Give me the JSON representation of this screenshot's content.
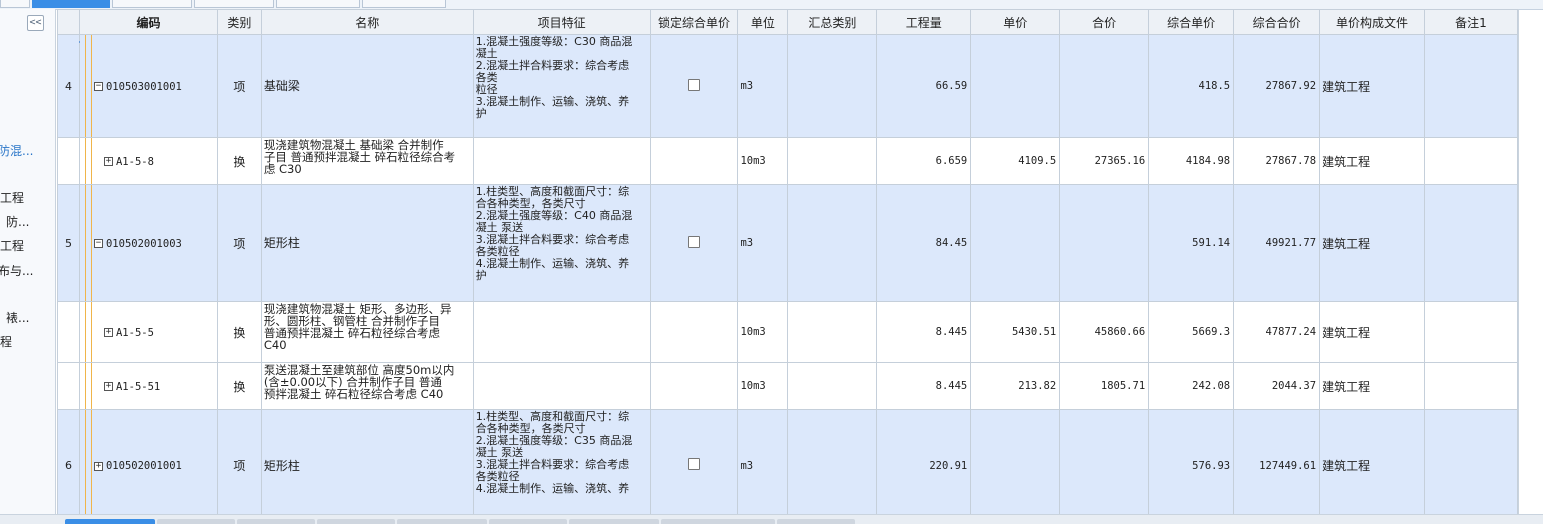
{
  "sidebar": {
    "collapse_label": "<<",
    "items": [
      "防混...",
      "工程",
      "防...",
      "工程",
      "布与...",
      "裱...",
      "程"
    ]
  },
  "columns": [
    "",
    "编码",
    "类别",
    "名称",
    "项目特征",
    "锁定综合单价",
    "单位",
    "汇总类别",
    "工程量",
    "单价",
    "合价",
    "综合单价",
    "综合合价",
    "单价构成文件",
    "备注1"
  ],
  "rows": [
    {
      "type": "item",
      "idx": "4",
      "expand": "−",
      "code": "010503001001",
      "cat": "项",
      "name": "基础梁",
      "desc": [
        "1.混凝土强度等级：C30 商品混",
        "凝土",
        "2.混凝土拌合料要求：综合考虑",
        "各类",
        "粒径",
        "3.混凝土制作、运输、浇筑、养",
        "护"
      ],
      "unit": "m3",
      "qty": "66.59",
      "price": "",
      "total": "",
      "comp_price": "418.5",
      "comp_total": "27867.92",
      "file": "建筑工程"
    },
    {
      "type": "sub",
      "idx": "",
      "expand": "+",
      "code": "A1-5-8",
      "cat": "换",
      "name_lines": [
        "现浇建筑物混凝土 基础梁  合并制作",
        "子目 普通预拌混凝土 碎石粒径综合考",
        "虑 C30"
      ],
      "unit": "10m3",
      "qty": "6.659",
      "price": "4109.5",
      "total": "27365.16",
      "comp_price": "4184.98",
      "comp_total": "27867.78",
      "file": "建筑工程"
    },
    {
      "type": "item",
      "idx": "5",
      "expand": "−",
      "code": "010502001003",
      "cat": "项",
      "name": "矩形柱",
      "desc": [
        "1.柱类型、高度和截面尺寸：综",
        "合各种类型，各类尺寸",
        "2.混凝土强度等级：C40 商品混",
        "凝土 泵送",
        "3.混凝土拌合料要求：综合考虑",
        "各类粒径",
        "4.混凝土制作、运输、浇筑、养",
        "护"
      ],
      "unit": "m3",
      "qty": "84.45",
      "price": "",
      "total": "",
      "comp_price": "591.14",
      "comp_total": "49921.77",
      "file": "建筑工程"
    },
    {
      "type": "sub",
      "idx": "",
      "expand": "+",
      "code": "A1-5-5",
      "cat": "换",
      "name_lines": [
        "现浇建筑物混凝土 矩形、多边形、异",
        "形、圆形柱、钢管柱  合并制作子目",
        "普通预拌混凝土 碎石粒径综合考虑",
        "C40"
      ],
      "unit": "10m3",
      "qty": "8.445",
      "price": "5430.51",
      "total": "45860.66",
      "comp_price": "5669.3",
      "comp_total": "47877.24",
      "file": "建筑工程"
    },
    {
      "type": "sub",
      "idx": "",
      "expand": "+",
      "code": "A1-5-51",
      "cat": "换",
      "name_lines": [
        "泵送混凝土至建筑部位 高度50m以内",
        "(含±0.00以下)  合并制作子目 普通",
        "预拌混凝土 碎石粒径综合考虑 C40"
      ],
      "unit": "10m3",
      "qty": "8.445",
      "price": "213.82",
      "total": "1805.71",
      "comp_price": "242.08",
      "comp_total": "2044.37",
      "file": "建筑工程"
    },
    {
      "type": "item",
      "idx": "6",
      "expand": "+",
      "code": "010502001001",
      "cat": "项",
      "name": "矩形柱",
      "desc": [
        "1.柱类型、高度和截面尺寸：综",
        "合各种类型，各类尺寸",
        "2.混凝土强度等级：C35 商品混",
        "凝土 泵送",
        "3.混凝土拌合料要求：综合考虑",
        "各类粒径",
        "4.混凝土制作、运输、浇筑、养"
      ],
      "unit": "m3",
      "qty": "220.91",
      "price": "",
      "total": "",
      "comp_price": "576.93",
      "comp_total": "127449.61",
      "file": "建筑工程"
    }
  ]
}
